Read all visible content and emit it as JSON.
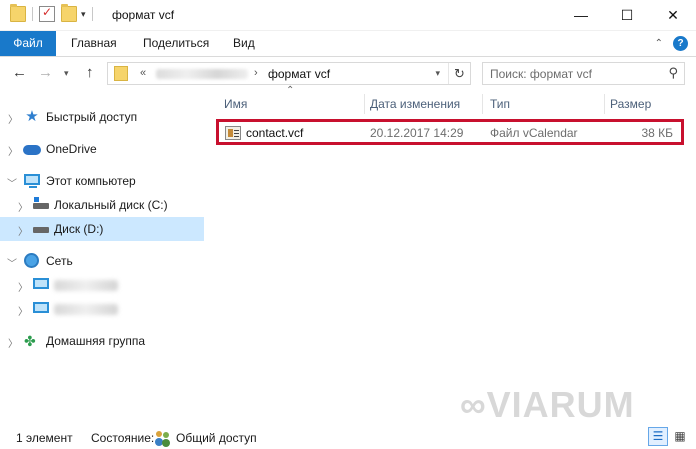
{
  "window": {
    "title": "формат vcf",
    "minimize_glyph": "—",
    "maximize_glyph": "☐",
    "close_glyph": "✕"
  },
  "ribbon": {
    "tabs": [
      {
        "label": "Файл"
      },
      {
        "label": "Главная"
      },
      {
        "label": "Поделиться"
      },
      {
        "label": "Вид"
      }
    ],
    "help_glyph": "?"
  },
  "address": {
    "prefix": "«",
    "separator": "›",
    "current": "формат vcf"
  },
  "search": {
    "placeholder": "Поиск: формат vcf"
  },
  "nav": {
    "quick_access": "Быстрый доступ",
    "onedrive": "OneDrive",
    "this_pc": "Этот компьютер",
    "local_disk": "Локальный диск (C:)",
    "disk_d": "Диск (D:)",
    "network": "Сеть",
    "homegroup": "Домашняя группа"
  },
  "columns": {
    "name": "Имя",
    "date": "Дата изменения",
    "type": "Тип",
    "size": "Размер"
  },
  "files": [
    {
      "name": "contact.vcf",
      "date": "20.12.2017 14:29",
      "type": "Файл vCalendar",
      "size": "38 КБ"
    }
  ],
  "status": {
    "count": "1 элемент",
    "state_label": "Состояние:",
    "state_value": "Общий доступ"
  },
  "watermark": "VIARUM",
  "colors": {
    "file_tab": "#1979ca",
    "selected_nav": "#cce8ff",
    "highlight_border": "#c8102e"
  }
}
